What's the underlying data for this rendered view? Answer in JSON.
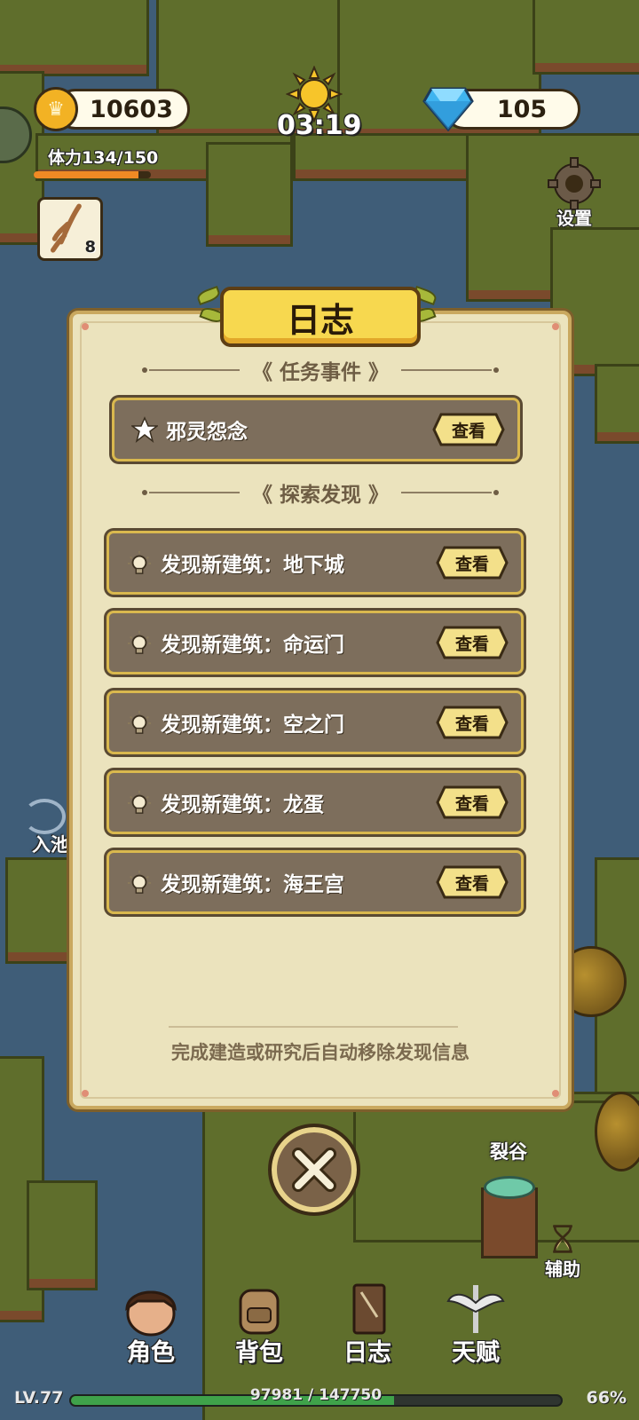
{
  "hud": {
    "coins": "10603",
    "gems": "105",
    "timer": "03:19",
    "stamina_label": "体力134/150",
    "stamina_fraction": 0.893,
    "item_count": "8",
    "settings_label": "设置"
  },
  "map_labels": {
    "pool": "入池",
    "rift": "裂谷",
    "assist": "辅助"
  },
  "dialog": {
    "title": "日志",
    "tasks_heading": "任务事件",
    "explore_heading": "探索发现",
    "view_label": "查看",
    "tasks": [
      {
        "text": "邪灵怨念"
      }
    ],
    "discoveries": [
      {
        "text": "发现新建筑：地下城"
      },
      {
        "text": "发现新建筑：命运门"
      },
      {
        "text": "发现新建筑：空之门"
      },
      {
        "text": "发现新建筑：龙蛋"
      },
      {
        "text": "发现新建筑：海王宫"
      }
    ],
    "footer_note": "完成建造或研究后自动移除发现信息"
  },
  "nav": {
    "items": [
      {
        "label": "角色",
        "icon": "character-icon"
      },
      {
        "label": "背包",
        "icon": "backpack-icon"
      },
      {
        "label": "日志",
        "icon": "journal-icon"
      },
      {
        "label": "天赋",
        "icon": "talent-icon"
      }
    ]
  },
  "xp": {
    "level": "LV.77",
    "progress_text": "97981 / 147750",
    "percent_text": "66%",
    "fraction": 0.66
  },
  "colors": {
    "water": "#3f5d78",
    "grass": "#5f6e2c",
    "panel": "#ebe3bd",
    "row": "#7d6e5c",
    "accent_gold": "#f7d84f",
    "xp_green": "#3fa24a",
    "stamina_orange": "#f08a24"
  }
}
